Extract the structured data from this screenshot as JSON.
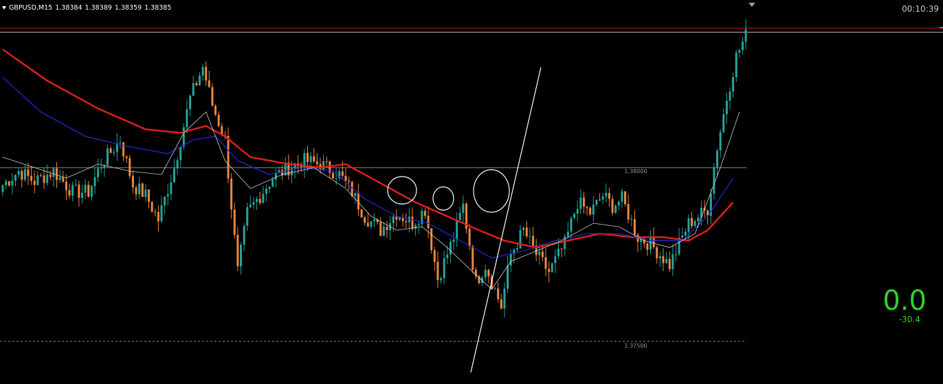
{
  "header": {
    "symbol": "GBPUSD,M15",
    "open": "1.38384",
    "high": "1.38389",
    "low": "1.38359",
    "close": "1.38385"
  },
  "countdown": "00:10:39",
  "levels": {
    "upper_label": "1.38000",
    "lower_label": "1.37500",
    "upper_value": 1.38,
    "lower_value": 1.375
  },
  "pnl": {
    "main": "0.0",
    "sub": "-30.4"
  },
  "colors": {
    "background": "#000000",
    "bull_candle": "#26a69a",
    "bear_candle": "#f0883e",
    "ma_slow": "#e01e1e",
    "ma_mid": "#1e2ad0",
    "ma_fast": "#d0d0d0",
    "pnl": "#2ed12e",
    "current_price_line": "#c81e1e"
  },
  "chart_data": {
    "type": "candlestick",
    "symbol": "GBPUSD",
    "timeframe": "M15",
    "price_range": [
      1.3742,
      1.3841
    ],
    "current_price": 1.38385,
    "horizontal_levels": [
      1.38,
      1.375
    ],
    "waypoints": [
      [
        0,
        1.3795
      ],
      [
        5,
        1.3799
      ],
      [
        10,
        1.3796
      ],
      [
        16,
        1.3799
      ],
      [
        22,
        1.3793
      ],
      [
        27,
        1.3793
      ],
      [
        31,
        1.3801
      ],
      [
        37,
        1.3808
      ],
      [
        41,
        1.3795
      ],
      [
        45,
        1.3792
      ],
      [
        49,
        1.3785
      ],
      [
        54,
        1.38
      ],
      [
        59,
        1.382
      ],
      [
        63,
        1.3829
      ],
      [
        66,
        1.3818
      ],
      [
        70,
        1.3808
      ],
      [
        74,
        1.377
      ],
      [
        77,
        1.3787
      ],
      [
        81,
        1.3792
      ],
      [
        85,
        1.3797
      ],
      [
        90,
        1.38
      ],
      [
        95,
        1.3802
      ],
      [
        100,
        1.3801
      ],
      [
        106,
        1.3798
      ],
      [
        110,
        1.3793
      ],
      [
        114,
        1.3786
      ],
      [
        119,
        1.3782
      ],
      [
        124,
        1.3787
      ],
      [
        129,
        1.3784
      ],
      [
        133,
        1.3788
      ],
      [
        137,
        1.3768
      ],
      [
        142,
        1.378
      ],
      [
        145,
        1.3789
      ],
      [
        149,
        1.3767
      ],
      [
        152,
        1.3772
      ],
      [
        157,
        1.376
      ],
      [
        160,
        1.3775
      ],
      [
        164,
        1.3782
      ],
      [
        168,
        1.3775
      ],
      [
        172,
        1.377
      ],
      [
        177,
        1.3778
      ],
      [
        181,
        1.379
      ],
      [
        185,
        1.3787
      ],
      [
        189,
        1.3792
      ],
      [
        192,
        1.3789
      ],
      [
        195,
        1.3791
      ],
      [
        200,
        1.378
      ],
      [
        204,
        1.3778
      ],
      [
        207,
        1.3775
      ],
      [
        210,
        1.3772
      ],
      [
        213,
        1.3778
      ],
      [
        216,
        1.3784
      ],
      [
        219,
        1.3786
      ],
      [
        222,
        1.3788
      ],
      [
        225,
        1.3806
      ],
      [
        228,
        1.382
      ],
      [
        231,
        1.3832
      ],
      [
        234,
        1.3838
      ]
    ],
    "moving_averages": [
      {
        "color": "#e01e1e",
        "points": [
          [
            0,
            1.3834
          ],
          [
            14,
            1.3825
          ],
          [
            30,
            1.3817
          ],
          [
            45,
            1.3811
          ],
          [
            56,
            1.381
          ],
          [
            64,
            1.3812
          ],
          [
            70,
            1.3809
          ],
          [
            78,
            1.3803
          ],
          [
            90,
            1.3801
          ],
          [
            100,
            1.38
          ],
          [
            108,
            1.3801
          ],
          [
            118,
            1.3796
          ],
          [
            130,
            1.379
          ],
          [
            140,
            1.3786
          ],
          [
            150,
            1.3782
          ],
          [
            158,
            1.3779
          ],
          [
            168,
            1.3777
          ],
          [
            178,
            1.3779
          ],
          [
            188,
            1.3781
          ],
          [
            198,
            1.378
          ],
          [
            208,
            1.378
          ],
          [
            216,
            1.3779
          ],
          [
            222,
            1.3782
          ],
          [
            230,
            1.379
          ]
        ]
      },
      {
        "color": "#1e2ad0",
        "points": [
          [
            0,
            1.3826
          ],
          [
            12,
            1.3816
          ],
          [
            26,
            1.3809
          ],
          [
            40,
            1.3806
          ],
          [
            52,
            1.3804
          ],
          [
            60,
            1.3808
          ],
          [
            67,
            1.3809
          ],
          [
            74,
            1.3802
          ],
          [
            84,
            1.3798
          ],
          [
            94,
            1.38
          ],
          [
            104,
            1.3799
          ],
          [
            114,
            1.3791
          ],
          [
            124,
            1.3786
          ],
          [
            134,
            1.3784
          ],
          [
            144,
            1.3779
          ],
          [
            154,
            1.3774
          ],
          [
            164,
            1.3776
          ],
          [
            174,
            1.3779
          ],
          [
            184,
            1.3781
          ],
          [
            194,
            1.3781
          ],
          [
            204,
            1.3779
          ],
          [
            214,
            1.3779
          ],
          [
            222,
            1.3786
          ],
          [
            230,
            1.3797
          ]
        ]
      },
      {
        "color": "#d0d0d0",
        "points": [
          [
            0,
            1.3803
          ],
          [
            10,
            1.38
          ],
          [
            20,
            1.3797
          ],
          [
            30,
            1.3801
          ],
          [
            40,
            1.3799
          ],
          [
            50,
            1.3798
          ],
          [
            57,
            1.381
          ],
          [
            64,
            1.3816
          ],
          [
            70,
            1.3802
          ],
          [
            78,
            1.3794
          ],
          [
            88,
            1.3798
          ],
          [
            98,
            1.38
          ],
          [
            108,
            1.3794
          ],
          [
            116,
            1.3786
          ],
          [
            124,
            1.3782
          ],
          [
            132,
            1.3783
          ],
          [
            140,
            1.3777
          ],
          [
            148,
            1.377
          ],
          [
            154,
            1.3765
          ],
          [
            160,
            1.3773
          ],
          [
            168,
            1.3776
          ],
          [
            176,
            1.3779
          ],
          [
            186,
            1.3784
          ],
          [
            194,
            1.3783
          ],
          [
            202,
            1.3779
          ],
          [
            210,
            1.3777
          ],
          [
            218,
            1.3781
          ],
          [
            226,
            1.38
          ],
          [
            232,
            1.3816
          ]
        ]
      }
    ]
  }
}
